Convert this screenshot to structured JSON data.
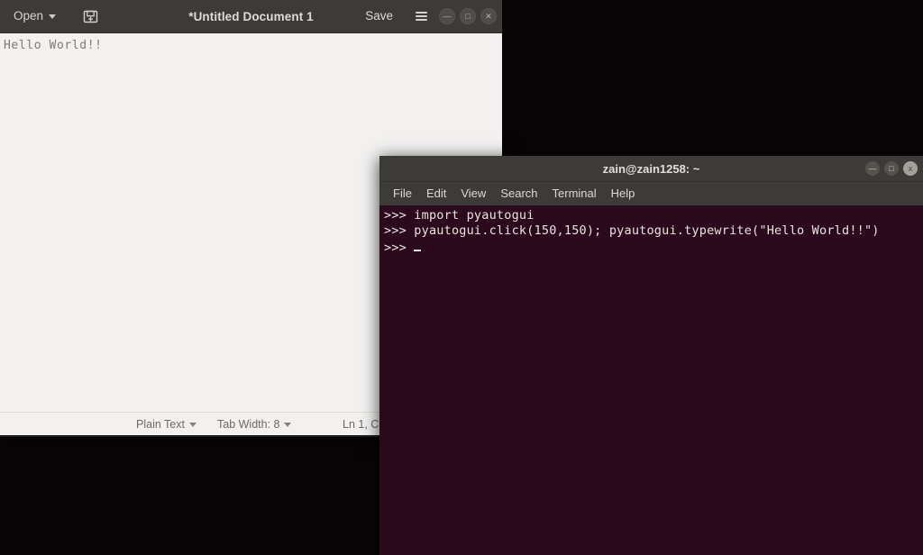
{
  "desktop": {
    "background_color": "#080506"
  },
  "gedit": {
    "window_name": "gedit-text-editor",
    "titlebar": {
      "open_label": "Open",
      "title": "*Untitled Document 1",
      "save_label": "Save",
      "save_icon": "save-document-icon",
      "menu_icon": "hamburger-menu-icon",
      "caret_icon": "chevron-down-icon",
      "window_buttons": [
        {
          "name": "minimize-button",
          "glyph": "—"
        },
        {
          "name": "maximize-button",
          "glyph": "□"
        },
        {
          "name": "close-button",
          "glyph": "✕"
        }
      ],
      "background_color": "#3c3b37",
      "text_color": "#dedbd8"
    },
    "editor": {
      "content": "Hello World!!",
      "background_color": "#f2f1f0",
      "text_color": "#7d7a77"
    },
    "statusbar": {
      "language_label": "Plain Text",
      "tab_width_label": "Tab Width: 8",
      "position_label": "Ln 1, C"
    }
  },
  "terminal": {
    "window_name": "gnome-terminal",
    "title": "zain@zain1258: ~",
    "window_buttons": [
      {
        "name": "minimize-button",
        "glyph": "—"
      },
      {
        "name": "maximize-button",
        "glyph": "□"
      },
      {
        "name": "close-button",
        "glyph": "x"
      }
    ],
    "menubar": [
      {
        "name": "menu-file",
        "label": "File"
      },
      {
        "name": "menu-edit",
        "label": "Edit"
      },
      {
        "name": "menu-view",
        "label": "View"
      },
      {
        "name": "menu-search",
        "label": "Search"
      },
      {
        "name": "menu-terminal",
        "label": "Terminal"
      },
      {
        "name": "menu-help",
        "label": "Help"
      }
    ],
    "background_color": "#2b0a1e",
    "text_color": "#e8e4de",
    "lines": [
      ">>> import pyautogui",
      ">>> pyautogui.click(150,150); pyautogui.typewrite(\"Hello World!!\")",
      ">>> "
    ]
  }
}
